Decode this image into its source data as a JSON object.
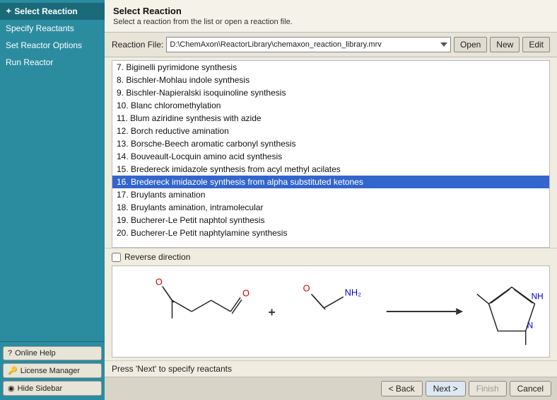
{
  "sidebar": {
    "items": [
      {
        "id": "select-reaction",
        "label": "Select Reaction",
        "active": true,
        "hasArrow": true
      },
      {
        "id": "specify-reactants",
        "label": "Specify Reactants",
        "active": false
      },
      {
        "id": "set-reactor-options",
        "label": "Set Reactor Options",
        "active": false
      },
      {
        "id": "run-reactor",
        "label": "Run Reactor",
        "active": false
      }
    ],
    "bottom_buttons": [
      {
        "id": "online-help",
        "label": "Online Help",
        "icon": "?"
      },
      {
        "id": "license-manager",
        "label": "License Manager",
        "icon": "🔑"
      },
      {
        "id": "hide-sidebar",
        "label": "Hide Sidebar",
        "icon": "◉"
      }
    ]
  },
  "header": {
    "title": "Select Reaction",
    "description": "Select a reaction from the list or open a reaction file."
  },
  "reaction_file": {
    "label": "Reaction File:",
    "value": "D:\\ChemAxon\\ReactorLibrary\\chemaxon_reaction_library.mrv",
    "buttons": [
      "Open",
      "New",
      "Edit"
    ]
  },
  "reaction_list": [
    {
      "id": 7,
      "text": "7. Biginelli pyrimidone synthesis"
    },
    {
      "id": 8,
      "text": "8. Bischler-Mohlau indole synthesis"
    },
    {
      "id": 9,
      "text": "9. Bischler-Napieralski isoquinoline synthesis"
    },
    {
      "id": 10,
      "text": "10. Blanc chloromethylation"
    },
    {
      "id": 11,
      "text": "11. Blum aziridine synthesis with azide"
    },
    {
      "id": 12,
      "text": "12. Borch reductive amination"
    },
    {
      "id": 13,
      "text": "13. Borsche-Beech aromatic carbonyl synthesis"
    },
    {
      "id": 14,
      "text": "14. Bouveault-Locquin amino acid synthesis"
    },
    {
      "id": 15,
      "text": "15. Bredereck imidazole synthesis from acyl methyl acilates"
    },
    {
      "id": 16,
      "text": "16. Bredereck imidazole synthesis from alpha substituted ketones",
      "selected": true
    },
    {
      "id": 17,
      "text": "17. Bruylants amination"
    },
    {
      "id": 18,
      "text": "18. Bruylants amination, intramolecular"
    },
    {
      "id": 19,
      "text": "19. Bucherer-Le Petit naphtol synthesis"
    },
    {
      "id": 20,
      "text": "20. Bucherer-Le Petit naphtylamine synthesis"
    }
  ],
  "reverse_direction": {
    "label": "Reverse direction",
    "checked": false
  },
  "status": "Press 'Next' to specify reactants",
  "footer": {
    "back_label": "< Back",
    "next_label": "Next >",
    "finish_label": "Finish",
    "cancel_label": "Cancel"
  }
}
